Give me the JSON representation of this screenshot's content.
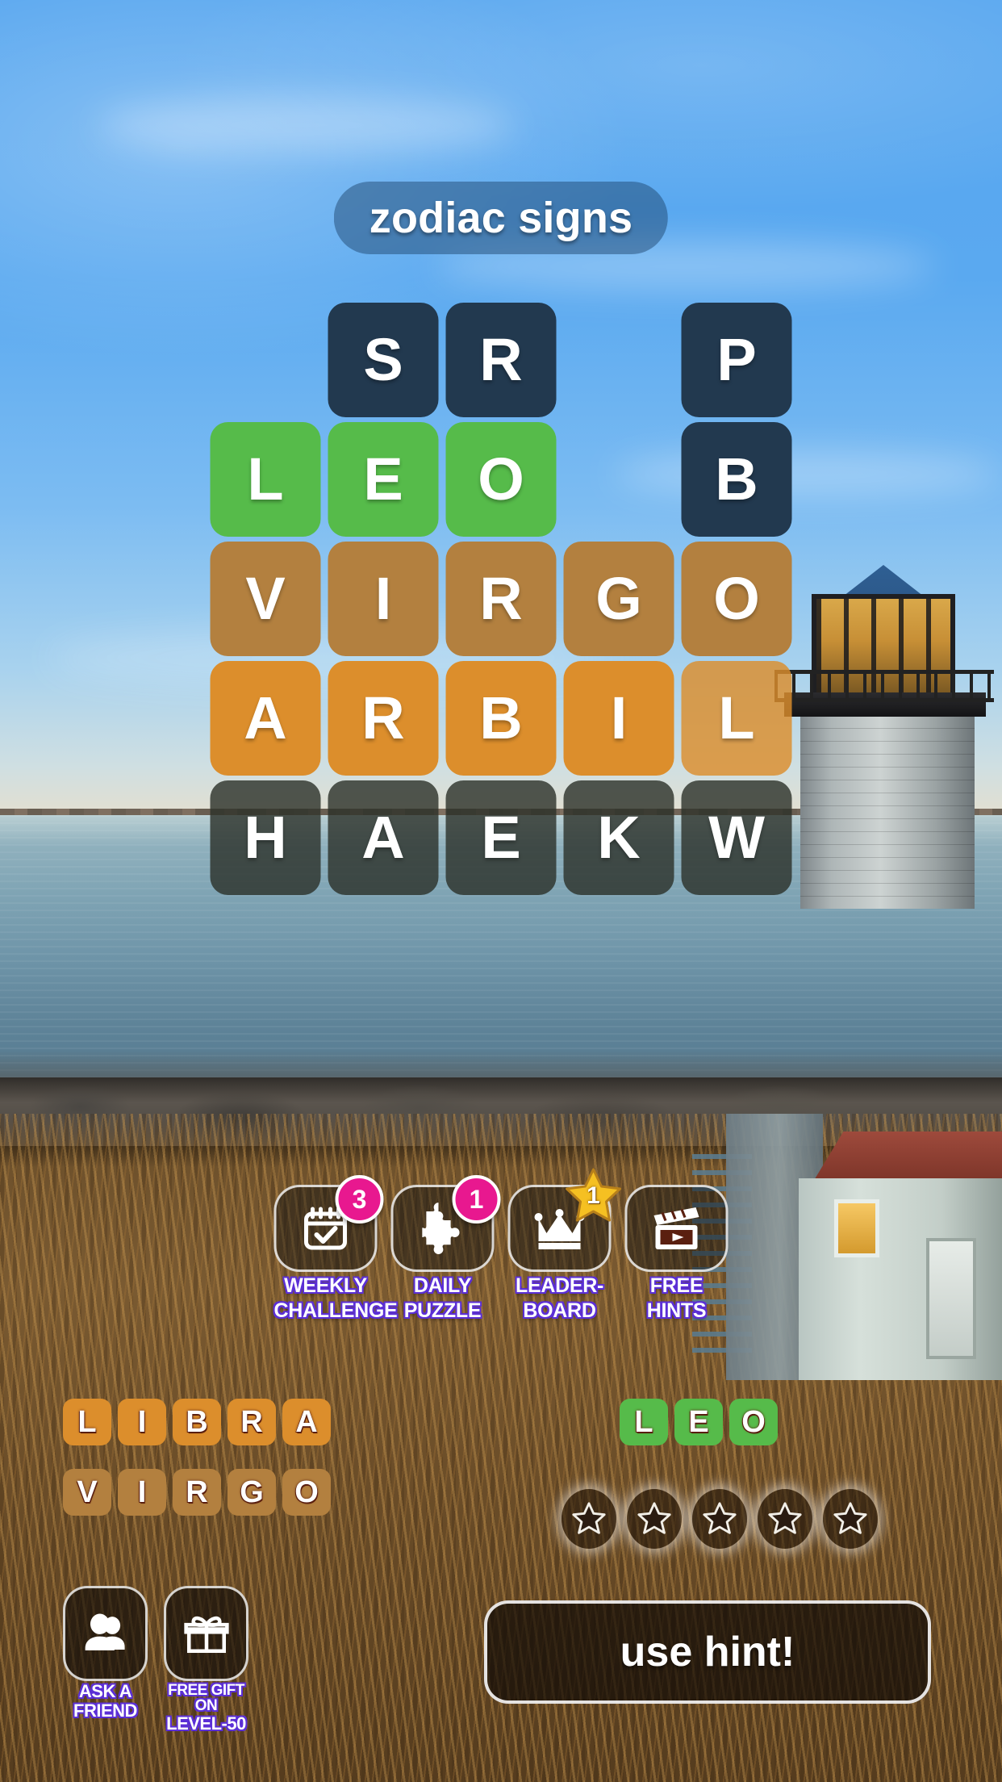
{
  "puzzle": {
    "title": "zodiac signs",
    "grid": {
      "columns": 5,
      "rows": [
        [
          {
            "letter": "",
            "state": "empty"
          },
          {
            "letter": "S",
            "state": "dark"
          },
          {
            "letter": "R",
            "state": "dark"
          },
          {
            "letter": "",
            "state": "empty"
          },
          {
            "letter": "P",
            "state": "dark"
          }
        ],
        [
          {
            "letter": "L",
            "state": "solved"
          },
          {
            "letter": "E",
            "state": "solved"
          },
          {
            "letter": "O",
            "state": "solved"
          },
          {
            "letter": "",
            "state": "empty"
          },
          {
            "letter": "B",
            "state": "dark"
          }
        ],
        [
          {
            "letter": "V",
            "state": "found-brown"
          },
          {
            "letter": "I",
            "state": "found-brown"
          },
          {
            "letter": "R",
            "state": "found-brown"
          },
          {
            "letter": "G",
            "state": "found-brown"
          },
          {
            "letter": "O",
            "state": "found-brown"
          }
        ],
        [
          {
            "letter": "A",
            "state": "found-orange"
          },
          {
            "letter": "R",
            "state": "found-orange"
          },
          {
            "letter": "B",
            "state": "found-orange"
          },
          {
            "letter": "I",
            "state": "found-orange"
          },
          {
            "letter": "L",
            "state": "found-orange-faded"
          }
        ],
        [
          {
            "letter": "H",
            "state": "shaded"
          },
          {
            "letter": "A",
            "state": "shaded"
          },
          {
            "letter": "E",
            "state": "shaded"
          },
          {
            "letter": "K",
            "state": "shaded"
          },
          {
            "letter": "W",
            "state": "shaded"
          }
        ]
      ]
    }
  },
  "features": [
    {
      "id": "weekly-challenge",
      "label_line1": "WEEKLY",
      "label_line2": "CHALLENGE",
      "icon": "calendar-check-icon",
      "badge": {
        "type": "pink-circle",
        "value": "3"
      }
    },
    {
      "id": "daily-puzzle",
      "label_line1": "DAILY",
      "label_line2": "PUZZLE",
      "icon": "puzzle-piece-icon",
      "badge": {
        "type": "pink-circle",
        "value": "1"
      }
    },
    {
      "id": "leaderboard",
      "label_line1": "LEADER-",
      "label_line2": "BOARD",
      "icon": "crown-icon",
      "badge": {
        "type": "gold-star",
        "value": "1"
      }
    },
    {
      "id": "free-hints",
      "label_line1": "FREE",
      "label_line2": "HINTS",
      "icon": "clapperboard-play-icon",
      "badge": null
    }
  ],
  "found_words": [
    {
      "word": "LIBRA",
      "color": "orange"
    },
    {
      "word": "VIRGO",
      "color": "brown"
    },
    {
      "word": "LEO",
      "color": "green"
    }
  ],
  "stars": {
    "total": 5,
    "earned": 0,
    "icon": "star-outline-icon"
  },
  "bottom_bar": {
    "ask_friend": {
      "label_line1": "ASK A",
      "label_line2": "FRIEND",
      "icon": "two-people-icon"
    },
    "free_gift": {
      "label_line1": "FREE GIFT ON",
      "label_line2": "LEVEL-50",
      "icon": "gift-icon"
    },
    "use_hint": {
      "label": "use hint!"
    }
  },
  "colors": {
    "tile_dark": "#22394f",
    "tile_green": "#56bb4a",
    "tile_brown": "#b3803f",
    "tile_orange": "#dc8e2c",
    "tile_shaded": "rgba(42,48,40,0.80)",
    "badge_pink": "#e8188f",
    "badge_gold": "#f5c022",
    "label_outline_purple": "#5b2fd6",
    "sky_blue": "#55a7f0"
  }
}
